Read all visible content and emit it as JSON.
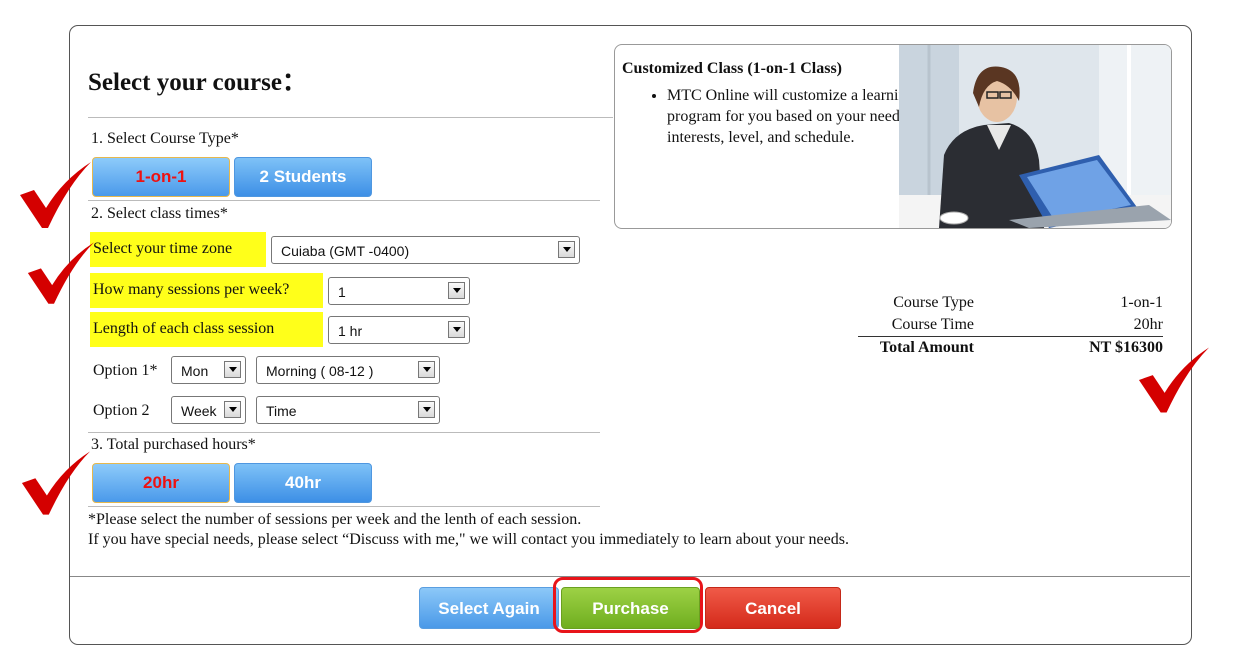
{
  "page": {
    "title": "Select your course："
  },
  "course_type": {
    "heading": "1. Select Course Type*",
    "options": [
      "1-on-1",
      "2 Students"
    ],
    "selected": "1-on-1"
  },
  "class_times": {
    "heading": "2. Select class times*",
    "time_zone_label": "Select your time zone",
    "time_zone_value": "Cuiaba (GMT -0400)",
    "sessions_label": "How many sessions per week?",
    "sessions_value": "1",
    "length_label": "Length of each class session",
    "length_value": "1 hr",
    "option1_label": "Option 1*",
    "option1_day": "Mon",
    "option1_time": "Morning ( 08-12 )",
    "option2_label": "Option 2",
    "option2_day": "Week",
    "option2_time": "Time"
  },
  "hours": {
    "heading": "3. Total purchased hours*",
    "options": [
      "20hr",
      "40hr"
    ],
    "selected": "20hr"
  },
  "notes": {
    "line1": "*Please select the number of sessions per week and the lenth of each session.",
    "line2": "If you have special needs, please select “Discuss with me,\" we will contact you immediately to learn about your needs."
  },
  "info_box": {
    "title": "Customized Class (1-on-1 Class)",
    "bullet": "MTC Online will customize a learning program for you based on your needs, interests, level, and schedule."
  },
  "summary": {
    "rows": [
      {
        "label": "Course Type",
        "value": "1-on-1"
      },
      {
        "label": "Course Time",
        "value": "20hr"
      }
    ],
    "total_label": "Total Amount",
    "total_value": "NT $16300"
  },
  "footer": {
    "select_again": "Select Again",
    "purchase": "Purchase",
    "cancel": "Cancel"
  },
  "colors": {
    "highlight": "#ffff1a",
    "checkmark": "#d40000",
    "purchase_green": "#7cbd2a",
    "cancel_red": "#e03a2a",
    "button_blue": "#4a9ae8"
  }
}
